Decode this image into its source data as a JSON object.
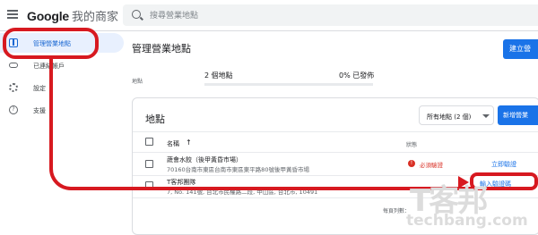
{
  "topbar": {
    "brand_google": "Google",
    "brand_product": "我的商家",
    "search_placeholder": "搜尋營業地點"
  },
  "sidebar": {
    "items": [
      {
        "label": "管理營業地點",
        "icon": "location-icon",
        "active": true
      },
      {
        "label": "已連結帳戶",
        "icon": "link-icon",
        "active": false
      },
      {
        "label": "設定",
        "icon": "gear-icon",
        "active": false
      },
      {
        "label": "支援",
        "icon": "help-icon",
        "active": false
      }
    ]
  },
  "main": {
    "title": "管理營業地點",
    "create_button": "建立營",
    "stats": {
      "label": "地點",
      "count_text": "2 個地點",
      "published_text": "0% 已發佈",
      "published_fraction": 0
    }
  },
  "card": {
    "title": "地點",
    "filter_label": "所有地點 (2 個)",
    "new_button": "新增營業",
    "columns": {
      "name": "名稱",
      "status": "狀態"
    },
    "rows": [
      {
        "name": "蔬會水餃（後甲黃昏市場）",
        "address": "70160台南市東區台南市東區東平路80號後甲黃昏市場",
        "status": "必須驗證",
        "action": "立即驗證"
      },
      {
        "name": "T客邦團隊",
        "address": "7, No. 141號, 台北市民權路二段, 中山區, 台北市, 10491",
        "status": "",
        "action": "輸入驗證碼"
      }
    ],
    "footer": "每頁列數："
  },
  "watermark": {
    "big": "T客邦",
    "url": "techbang.com"
  },
  "colors": {
    "accent": "#1a73e8",
    "annotation": "#d71920",
    "error": "#d93025"
  }
}
